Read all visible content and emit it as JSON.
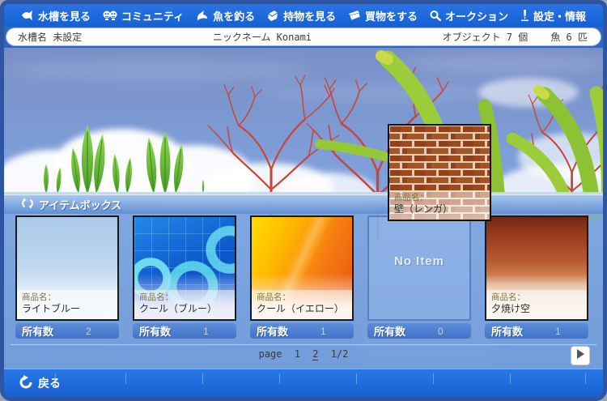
{
  "nav": {
    "items": [
      {
        "label": "水槽を見る",
        "icon": "fish-icon"
      },
      {
        "label": "コミュニティ",
        "icon": "community-icon"
      },
      {
        "label": "魚を釣る",
        "icon": "fishing-icon"
      },
      {
        "label": "持物を見る",
        "icon": "belongings-icon"
      },
      {
        "label": "買物をする",
        "icon": "shopping-icon"
      },
      {
        "label": "オークション",
        "icon": "auction-icon"
      },
      {
        "label": "設定・情報",
        "icon": "settings-icon"
      }
    ]
  },
  "status_bar": {
    "tank_name": "水槽名 未設定",
    "nickname": "ニックネーム Konami",
    "object_count": "オブジェクト 7 個",
    "fish_count": "魚 6 匹"
  },
  "item_box": {
    "title": "アイテムボックス",
    "product_label": "商品名：",
    "owned_label": "所有数",
    "slots": [
      {
        "name": "ライトブルー",
        "count": "2"
      },
      {
        "name": "クール（ブルー）",
        "count": "1"
      },
      {
        "name": "クール（イエロー）",
        "count": "1"
      },
      {
        "name": "",
        "count": "0",
        "empty_label": "No Item"
      },
      {
        "name": "夕焼け空",
        "count": "1"
      }
    ]
  },
  "popup": {
    "product_label": "商品名：",
    "name": "壁（レンガ）"
  },
  "pagination": {
    "label": "page",
    "pages": [
      "1",
      "2"
    ],
    "current": "2",
    "fraction": "1/2"
  },
  "footer": {
    "back_label": "戻る"
  },
  "colors": {
    "nav_blue": "#1460d4",
    "footer_blue": "#1660d2",
    "panel_blue": "#6f9ad8",
    "owned_bar_blue": "#3f74ca",
    "frame_border": "#2d55a2",
    "brick": "#9c4a1e",
    "coral_red": "#c8453a",
    "leaf_green": "#6cbe34"
  }
}
